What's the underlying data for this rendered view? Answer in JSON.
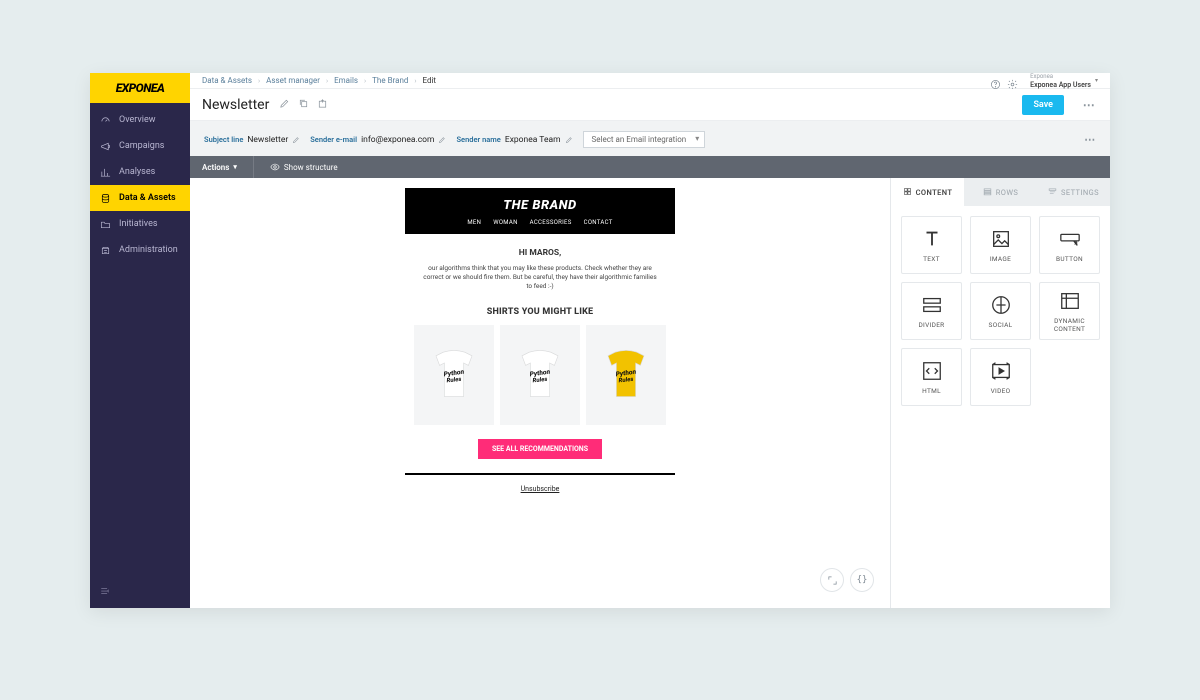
{
  "brand": "EXPONEA",
  "breadcrumbs": [
    "Data & Assets",
    "Asset manager",
    "Emails",
    "The Brand",
    "Edit"
  ],
  "account": {
    "top": "Exponea",
    "bottom": "Exponea App Users"
  },
  "page_title": "Newsletter",
  "save_label": "Save",
  "nav": [
    {
      "icon": "gauge",
      "label": "Overview"
    },
    {
      "icon": "campaign",
      "label": "Campaigns"
    },
    {
      "icon": "chart",
      "label": "Analyses"
    },
    {
      "icon": "data",
      "label": "Data & Assets",
      "active": true
    },
    {
      "icon": "folder",
      "label": "Initiatives"
    },
    {
      "icon": "admin",
      "label": "Administration"
    }
  ],
  "subject": {
    "subject_label": "Subject line",
    "subject_value": "Newsletter",
    "sender_email_label": "Sender e-mail",
    "sender_email_value": "info@exponea.com",
    "sender_name_label": "Sender name",
    "sender_name_value": "Exponea Team",
    "integration_placeholder": "Select an Email integration"
  },
  "actionbar": {
    "actions": "Actions",
    "show_structure": "Show structure"
  },
  "email": {
    "brand": "THE BRAND",
    "menu": [
      "MEN",
      "WOMAN",
      "ACCESSORIES",
      "CONTACT"
    ],
    "greeting": "HI MAROS,",
    "paragraph": "our algorithms think that you may like these products. Check whether they are correct or we should fire them. But be careful, they have their algorithmic families to feed :-)",
    "section": "SHIRTS YOU MIGHT LIKE",
    "cta": "SEE ALL RECOMMENDATIONS",
    "unsubscribe": "Unsubscribe",
    "shirts": [
      {
        "color": "#ffffff",
        "text_color": "#111"
      },
      {
        "color": "#ffffff",
        "text_color": "#111"
      },
      {
        "color": "#f2c200",
        "text_color": "#111"
      }
    ]
  },
  "panel": {
    "tabs": [
      "CONTENT",
      "ROWS",
      "SETTINGS"
    ],
    "blocks": [
      {
        "label": "TEXT",
        "icon": "text"
      },
      {
        "label": "IMAGE",
        "icon": "image"
      },
      {
        "label": "BUTTON",
        "icon": "button"
      },
      {
        "label": "DIVIDER",
        "icon": "divider"
      },
      {
        "label": "SOCIAL",
        "icon": "social"
      },
      {
        "label": "DYNAMIC CONTENT",
        "icon": "dynamic"
      },
      {
        "label": "HTML",
        "icon": "html"
      },
      {
        "label": "VIDEO",
        "icon": "video"
      }
    ]
  }
}
